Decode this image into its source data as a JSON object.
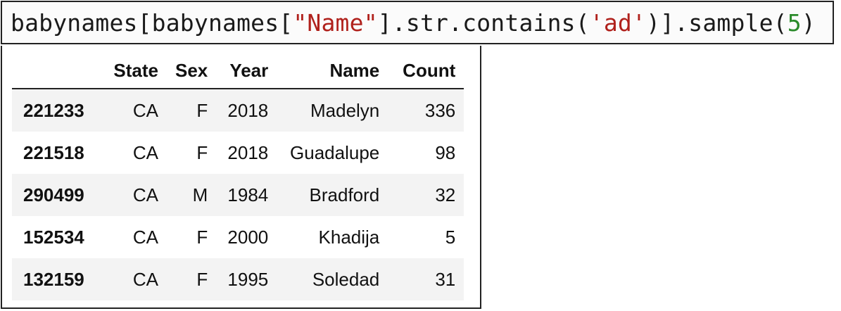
{
  "code": {
    "part1": "babynames[babynames[",
    "string1": "\"Name\"",
    "part2": "].str.contains(",
    "string2": "'ad'",
    "part3": ")].sample(",
    "number": "5",
    "part4": ")",
    "colors": {
      "string": "#b0211c",
      "number": "#2a8a2a"
    }
  },
  "table": {
    "columns": [
      "",
      "State",
      "Sex",
      "Year",
      "Name",
      "Count"
    ],
    "rows": [
      {
        "index": "221233",
        "state": "CA",
        "sex": "F",
        "year": "2018",
        "name": "Madelyn",
        "count": "336"
      },
      {
        "index": "221518",
        "state": "CA",
        "sex": "F",
        "year": "2018",
        "name": "Guadalupe",
        "count": "98"
      },
      {
        "index": "290499",
        "state": "CA",
        "sex": "M",
        "year": "1984",
        "name": "Bradford",
        "count": "32"
      },
      {
        "index": "152534",
        "state": "CA",
        "sex": "F",
        "year": "2000",
        "name": "Khadija",
        "count": "5"
      },
      {
        "index": "132159",
        "state": "CA",
        "sex": "F",
        "year": "1995",
        "name": "Soledad",
        "count": "31"
      }
    ]
  }
}
